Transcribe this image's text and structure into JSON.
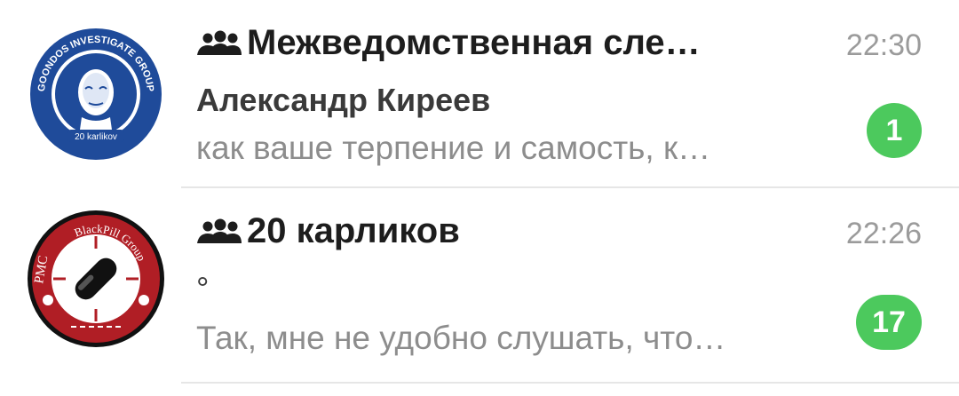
{
  "chats": [
    {
      "title": "Межведомственная сле…",
      "time": "22:30",
      "sender": "Александр Киреев",
      "preview": "как ваше терпение и самость, к…",
      "unread": "1",
      "avatar": {
        "ring_top_text": "GOONDOS INVESTIGATE GROUP",
        "ring_bottom_text": "20 karlikov",
        "bg_color": "#1f4b9a"
      }
    },
    {
      "title": "20 карликов",
      "time": "22:26",
      "sender": "°",
      "preview": "Так, мне не удобно слушать, что…",
      "unread": "17",
      "avatar": {
        "ring_left_text": "PMC",
        "ring_top_text": "BlackPill Group",
        "bg_color": "#b01e25"
      }
    }
  ],
  "colors": {
    "badge": "#4cc95d",
    "time": "#9b9b9b",
    "preview": "#8d8d8d",
    "title": "#1d1d1d"
  }
}
